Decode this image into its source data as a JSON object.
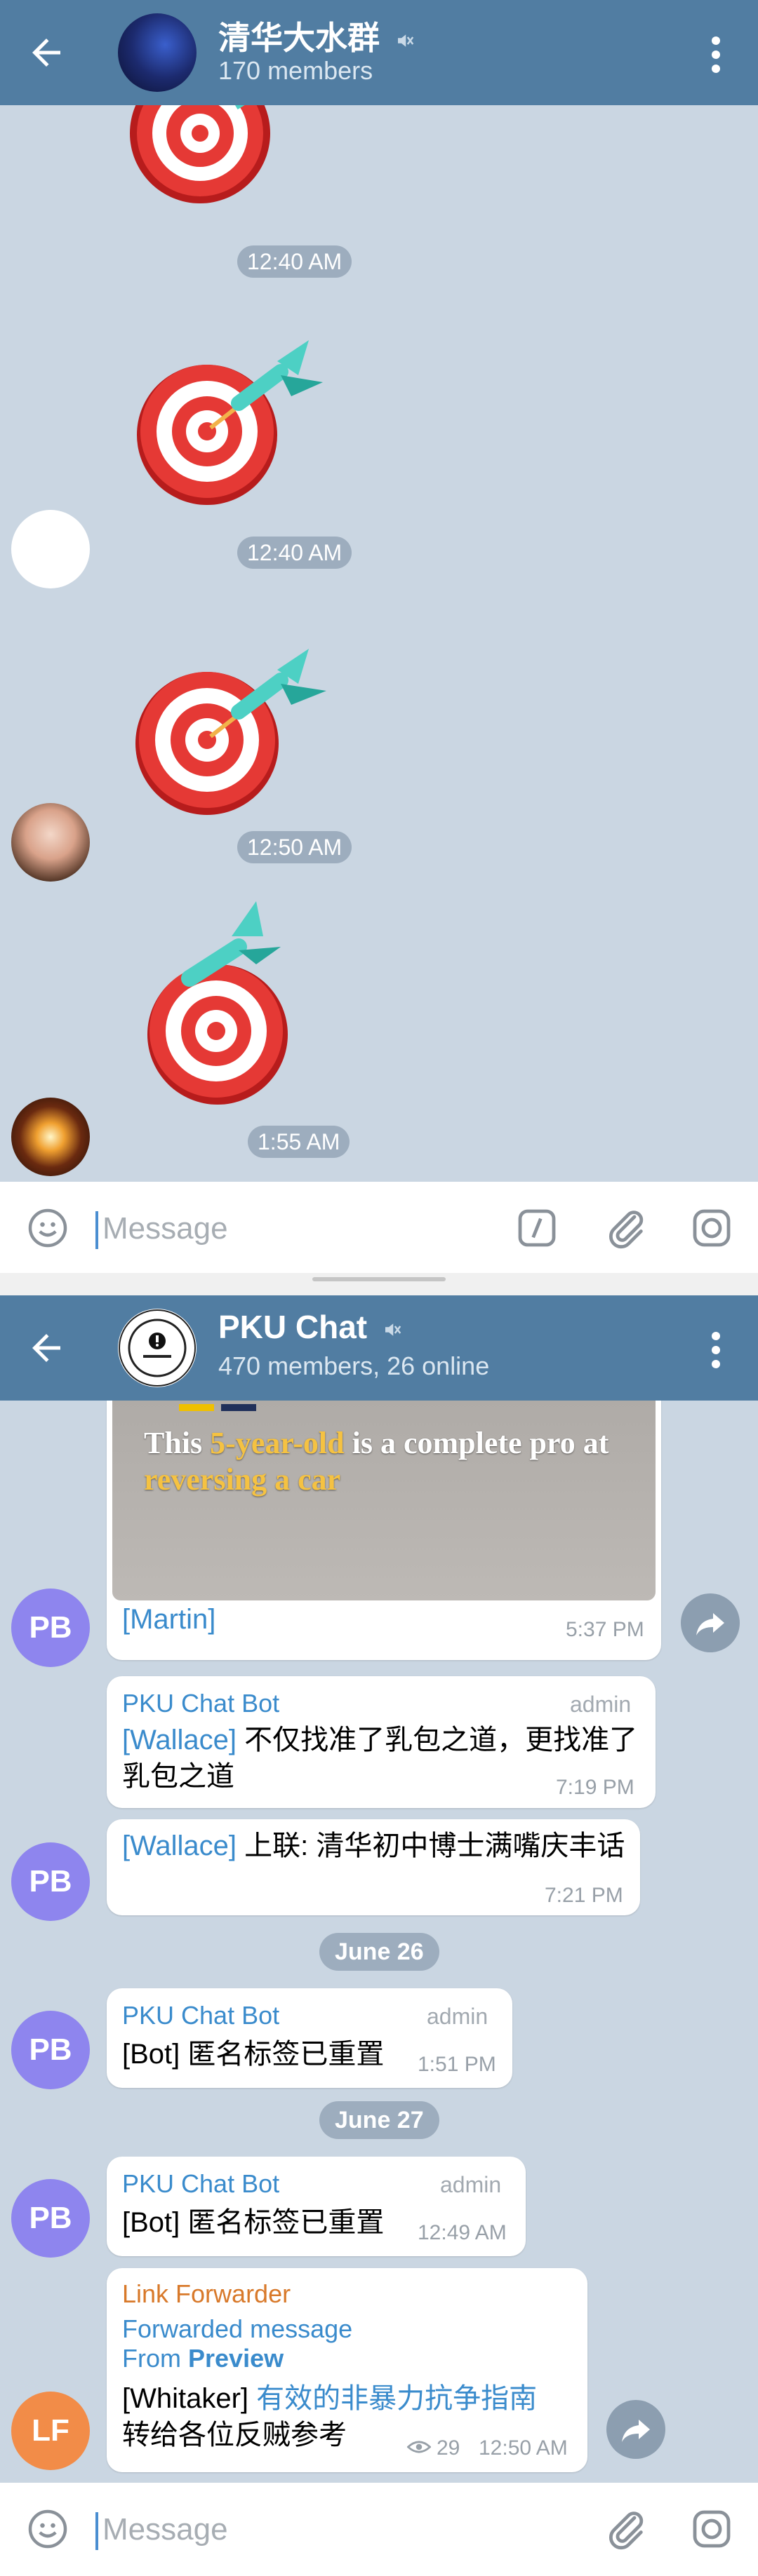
{
  "top_chat": {
    "title": "清华大水群",
    "subtitle": "170 members",
    "timestamps": [
      "12:40 AM",
      "12:40 AM",
      "12:50 AM",
      "1:55 AM"
    ],
    "input_placeholder": "Message"
  },
  "bottom_chat": {
    "title": "PKU Chat",
    "subtitle": "470 members, 26 online",
    "input_placeholder": "Message",
    "video_caption": {
      "prefix": "This ",
      "highlight1": "5-year-old",
      "middle": " is a complete pro at",
      "highlight2": "reversing a car"
    },
    "messages": [
      {
        "avatar": "PB",
        "text": "[Martin]",
        "time": "5:37 PM"
      },
      {
        "sender": "PKU Chat Bot",
        "role": "admin",
        "name": "[Wallace]",
        "text": " 不仅找准了乳包之道，更找准了乳包之道",
        "time": "7:19 PM"
      },
      {
        "avatar": "PB",
        "name": "[Wallace]",
        "text": " 上联: 清华初中博士满嘴庆丰话",
        "time": "7:21 PM"
      },
      {
        "date": "June 26"
      },
      {
        "avatar": "PB",
        "sender": "PKU Chat Bot",
        "role": "admin",
        "text": "[Bot] 匿名标签已重置",
        "time": "1:51 PM"
      },
      {
        "date": "June 27"
      },
      {
        "avatar": "PB",
        "sender": "PKU Chat Bot",
        "role": "admin",
        "text": "[Bot] 匿名标签已重置",
        "time": "12:49 AM"
      },
      {
        "avatar": "LF",
        "sender": "Link Forwarder",
        "forwarded": "Forwarded message",
        "from_prefix": "From ",
        "from_name": "Preview",
        "name": "[Whitaker]",
        "link_text": "有效的非暴力抗争指南",
        "text2": "转给各位反贼参考",
        "views": "29",
        "time": "12:50 AM"
      }
    ]
  },
  "colors": {
    "header": "#517da2",
    "chat_background": "#cad6e2",
    "pb_avatar": "#8e85ee",
    "lf_avatar": "#f28c48",
    "link": "#3a8bcc",
    "forwarder_name": "#d8792a"
  },
  "icons": [
    "back-arrow-icon",
    "mute-icon",
    "more-vert-icon",
    "emoji-icon",
    "bot-command-icon",
    "attach-icon",
    "camera-icon",
    "share-icon",
    "eye-icon"
  ]
}
